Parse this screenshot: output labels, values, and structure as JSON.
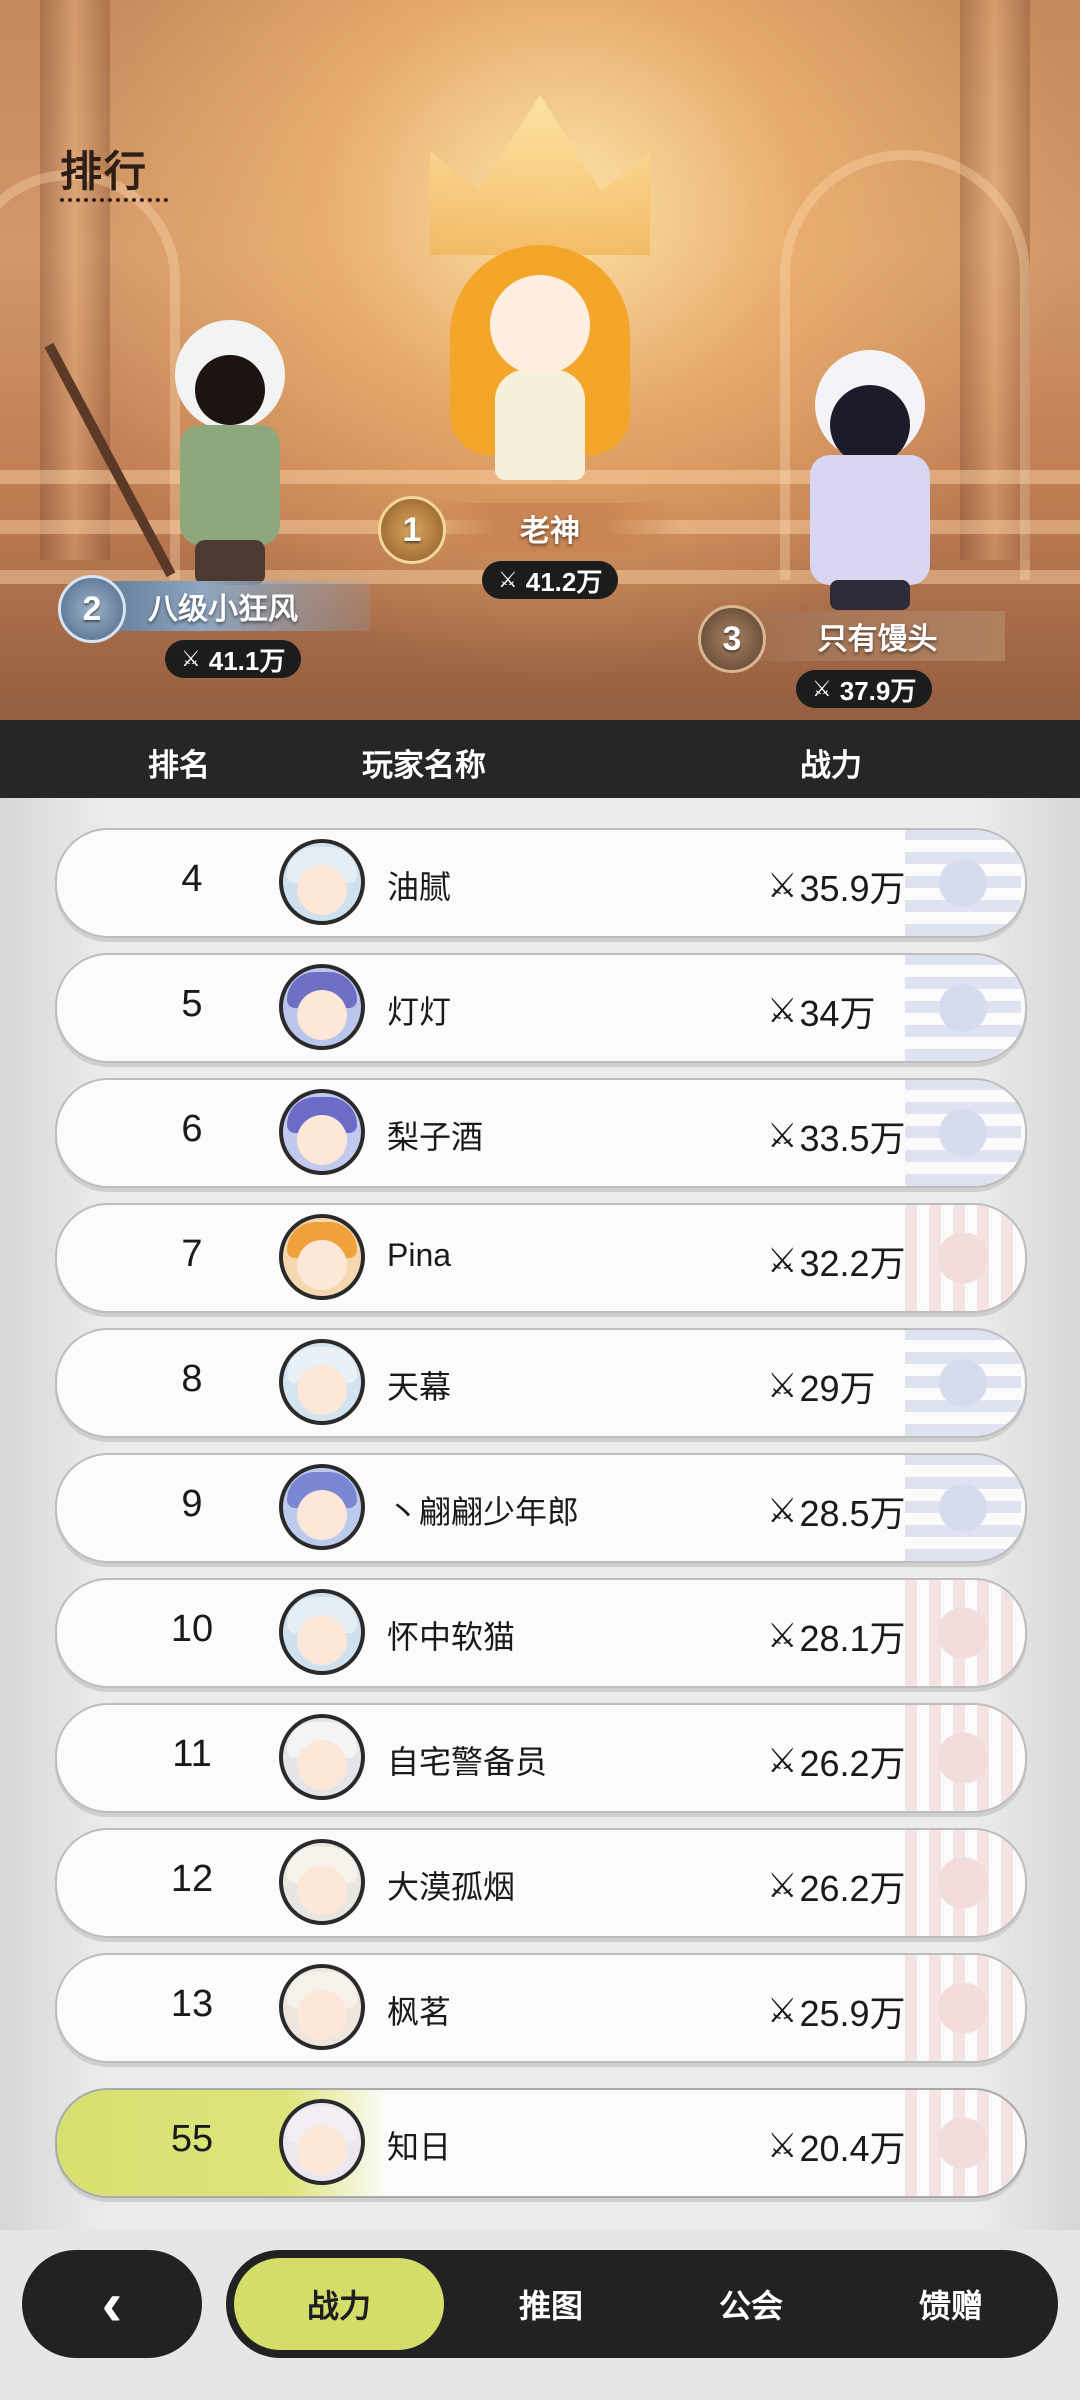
{
  "page": {
    "title": "排行"
  },
  "podium": [
    {
      "rank": "1",
      "name": "老神",
      "power": "41.2万"
    },
    {
      "rank": "2",
      "name": "八级小狂风",
      "power": "41.1万"
    },
    {
      "rank": "3",
      "name": "只有馒头",
      "power": "37.9万"
    }
  ],
  "table": {
    "headers": [
      "排名",
      "玩家名称",
      "战力"
    ]
  },
  "rows": [
    {
      "rank": "4",
      "name": "油腻",
      "power": "35.9万",
      "emblem": "blue"
    },
    {
      "rank": "5",
      "name": "灯灯",
      "power": "34万",
      "emblem": "blue"
    },
    {
      "rank": "6",
      "name": "梨子酒",
      "power": "33.5万",
      "emblem": "blue"
    },
    {
      "rank": "7",
      "name": "Pina",
      "power": "32.2万",
      "emblem": "red"
    },
    {
      "rank": "8",
      "name": "天幕",
      "power": "29万",
      "emblem": "blue"
    },
    {
      "rank": "9",
      "name": "丶翩翩少年郎",
      "power": "28.5万",
      "emblem": "blue"
    },
    {
      "rank": "10",
      "name": "怀中软猫",
      "power": "28.1万",
      "emblem": "red"
    },
    {
      "rank": "11",
      "name": "自宅警备员",
      "power": "26.2万",
      "emblem": "red"
    },
    {
      "rank": "12",
      "name": "大漠孤烟",
      "power": "26.2万",
      "emblem": "red"
    },
    {
      "rank": "13",
      "name": "枫茗",
      "power": "25.9万",
      "emblem": "red"
    }
  ],
  "me": {
    "rank": "55",
    "name": "知日",
    "power": "20.4万"
  },
  "nav": {
    "back_icon": "chevron-left-icon",
    "tabs": [
      "战力",
      "推图",
      "公会",
      "馈赠"
    ],
    "active": "战力"
  },
  "icons": {
    "power": "crossed-swords-icon"
  }
}
